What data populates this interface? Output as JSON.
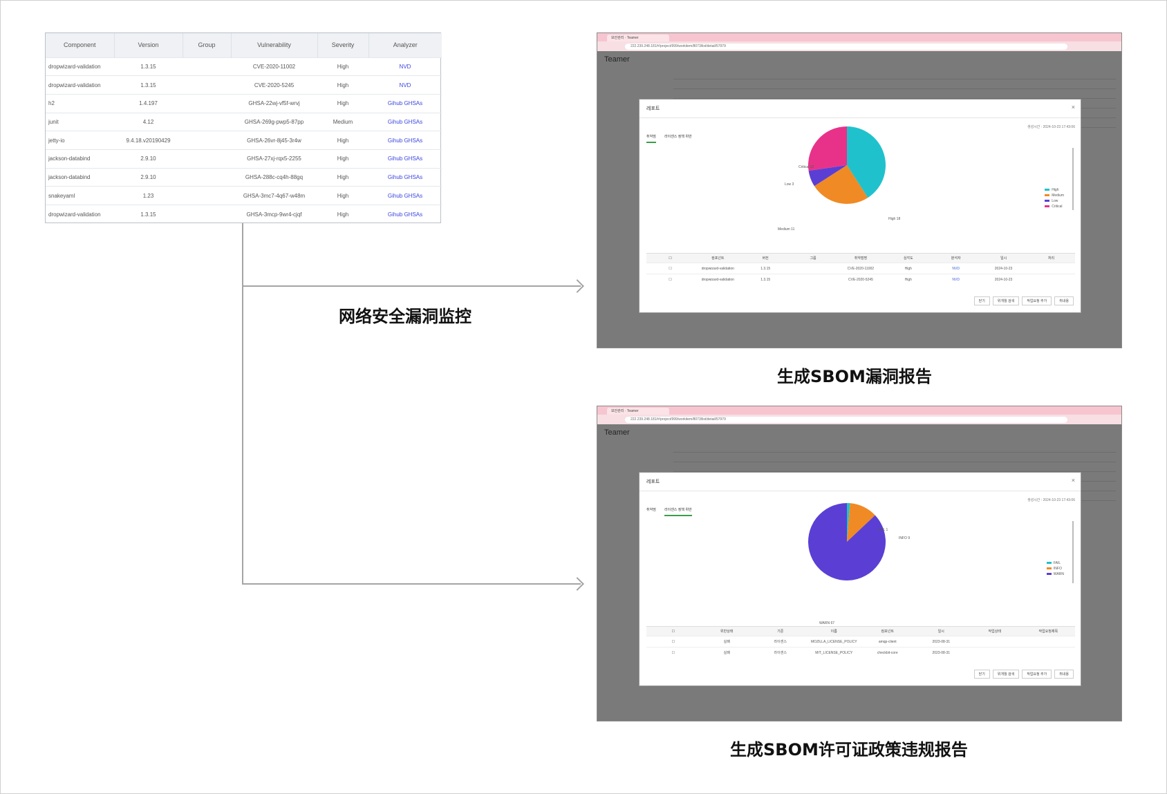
{
  "vuln_table": {
    "columns": [
      "Component",
      "Version",
      "Group",
      "Vulnerability",
      "Severity",
      "Analyzer"
    ],
    "rows": [
      [
        "dropwizard-validation",
        "1.3.15",
        "",
        "CVE-2020-11002",
        "High",
        "NVD"
      ],
      [
        "dropwizard-validation",
        "1.3.15",
        "",
        "CVE-2020-5245",
        "High",
        "NVD"
      ],
      [
        "h2",
        "1.4.197",
        "",
        "GHSA-22wj-vf5f-wrvj",
        "High",
        "Gihub GHSAs"
      ],
      [
        "junit",
        "4.12",
        "",
        "GHSA-269g-pwp5-87pp",
        "Medium",
        "Gihub GHSAs"
      ],
      [
        "jetty-io",
        "9.4.18.v20190429",
        "",
        "GHSA-26vr-8j45-3r4w",
        "High",
        "Gihub GHSAs"
      ],
      [
        "jackson-databind",
        "2.9.10",
        "",
        "GHSA-27xj-rqx5-2255",
        "High",
        "Gihub GHSAs"
      ],
      [
        "jackson-databind",
        "2.9.10",
        "",
        "GHSA-288c-cq4h-88gq",
        "High",
        "Gihub GHSAs"
      ],
      [
        "snakeyaml",
        "1.23",
        "",
        "GHSA-3mc7-4q67-w48m",
        "High",
        "Gihub GHSAs"
      ],
      [
        "dropwizard-validation",
        "1.3.15",
        "",
        "GHSA-3mcp-9wr4-cjqf",
        "High",
        "Gihub GHSAs"
      ]
    ]
  },
  "captions": {
    "monitor": "网络安全漏洞监控",
    "vuln_report": "生成SBOM漏洞报告",
    "license_report": "生成SBOM许可证政策违规报告"
  },
  "shots": [
    {
      "tab_title": "보안관리 · Teamer",
      "url": "222.239.248.181/#/project/999/workitem/8073/list/detail/57979",
      "brand": "Teamer",
      "modal_title": "레포트",
      "modal_date": "생성시간 : 2024-10-23 17:43:06",
      "tabs": [
        "취약점",
        "라이센스 정책 위반"
      ],
      "active_tab": 0,
      "legend": [
        "High",
        "Medium",
        "Low",
        "Critical"
      ],
      "colors": [
        "#1fc2cc",
        "#f08a24",
        "#5b3fd4",
        "#e8328a"
      ],
      "slice_labels": [
        "High 18",
        "Medium 11",
        "Low 3",
        "Critical 12"
      ],
      "table_headers": [
        "컴포넌트",
        "버전",
        "그룹",
        "취약점명",
        "심각도",
        "분석자",
        "일시",
        "처리"
      ],
      "table_rows": [
        [
          "dropwizard-validation",
          "1.3.15",
          "",
          "CVE-2020-11002",
          "High",
          "NVD",
          "2024-10-23",
          ""
        ],
        [
          "dropwizard-validation",
          "1.3.15",
          "",
          "CVE-2020-5245",
          "High",
          "NVD",
          "2024-10-23",
          ""
        ]
      ],
      "buttons": [
        "닫기",
        "위개월 검색",
        "작업요청 추가",
        "취내용"
      ]
    },
    {
      "tab_title": "보안관리 · Teamer",
      "url": "222.239.248.181/#/project/999/workitem/8073/list/detail/57979",
      "brand": "Teamer",
      "modal_title": "레포트",
      "modal_date": "생성시간 : 2024-10-23 17:43:06",
      "tabs": [
        "취약점",
        "라이센스 정책 위반"
      ],
      "active_tab": 1,
      "legend": [
        "FAIL",
        "INFO",
        "WARN"
      ],
      "colors": [
        "#1fc2cc",
        "#f08a24",
        "#5b3fd4"
      ],
      "slice_labels": [
        "FAIL 1",
        "INFO 9",
        "WARN 67"
      ],
      "table_headers": [
        "위반상태",
        "기준",
        "이름",
        "컴포넌트",
        "일시",
        "작업상태",
        "작업요청제목"
      ],
      "table_rows": [
        [
          "실패",
          "라이센스",
          "MOZILLA_LICENSE_POLICY",
          "amqp-client",
          "2023-08-31",
          "",
          ""
        ],
        [
          "실패",
          "라이센스",
          "MIT_LICENSE_POLICY",
          "checkbit-core",
          "2023-08-31",
          "",
          ""
        ]
      ],
      "buttons": [
        "닫기",
        "위개월 검색",
        "작업요청 추가",
        "취내용"
      ]
    }
  ],
  "chart_data": [
    {
      "type": "pie",
      "categories": [
        "High",
        "Medium",
        "Low",
        "Critical"
      ],
      "values": [
        18,
        11,
        3,
        12
      ]
    },
    {
      "type": "pie",
      "categories": [
        "FAIL",
        "INFO",
        "WARN"
      ],
      "values": [
        1,
        9,
        67
      ]
    }
  ]
}
